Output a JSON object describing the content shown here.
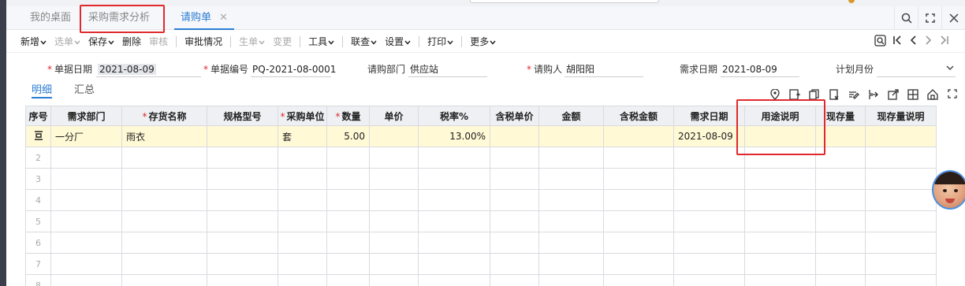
{
  "tabs": [
    {
      "label": "我的桌面"
    },
    {
      "label": "采购需求分析"
    },
    {
      "label": "请购单"
    }
  ],
  "tab_close_glyph": "✕",
  "window_tools": [
    "search-icon",
    "expand-icon",
    "close-icon"
  ],
  "toolbar": [
    {
      "label": "新增",
      "caret": true,
      "disabled": false
    },
    {
      "label": "选单",
      "caret": true,
      "disabled": true
    },
    {
      "label": "保存",
      "caret": true,
      "disabled": false
    },
    {
      "label": "删除",
      "caret": false,
      "disabled": false
    },
    {
      "label": "审核",
      "caret": false,
      "disabled": true
    },
    {
      "label": "审批情况",
      "caret": false,
      "disabled": false
    },
    {
      "label": "生单",
      "caret": true,
      "disabled": true
    },
    {
      "label": "变更",
      "caret": false,
      "disabled": true
    },
    {
      "label": "工具",
      "caret": true,
      "disabled": false
    },
    {
      "label": "联查",
      "caret": true,
      "disabled": false
    },
    {
      "label": "设置",
      "caret": true,
      "disabled": false
    },
    {
      "label": "打印",
      "caret": true,
      "disabled": false
    },
    {
      "label": "更多",
      "caret": true,
      "disabled": false
    }
  ],
  "form": {
    "date_label": "单据日期",
    "date_value": "2021-08-09",
    "code_label": "单据编号",
    "code_value": "PQ-2021-08-0001",
    "dept_label": "请购部门",
    "dept_value": "供应站",
    "person_label": "请购人",
    "person_value": "胡阳阳",
    "demand_date_label": "需求日期",
    "demand_date_value": "2021-08-09",
    "plan_month_label": "计划月份",
    "plan_month_value": ""
  },
  "subtabs": [
    {
      "label": "明细"
    },
    {
      "label": "汇总"
    }
  ],
  "table": {
    "columns": [
      {
        "label": "序号",
        "required": false
      },
      {
        "label": "需求部门",
        "required": false
      },
      {
        "label": "存货名称",
        "required": true
      },
      {
        "label": "规格型号",
        "required": false
      },
      {
        "label": "采购单位",
        "required": true
      },
      {
        "label": "数量",
        "required": true
      },
      {
        "label": "单价",
        "required": false
      },
      {
        "label": "税率%",
        "required": false
      },
      {
        "label": "含税单价",
        "required": false
      },
      {
        "label": "金额",
        "required": false
      },
      {
        "label": "含税金额",
        "required": false
      },
      {
        "label": "需求日期",
        "required": false
      },
      {
        "label": "用途说明",
        "required": false
      },
      {
        "label": "现存量",
        "required": false
      },
      {
        "label": "现存量说明",
        "required": false
      }
    ],
    "rows": [
      [
        "",
        "一分厂",
        "雨衣",
        "",
        "套",
        "5.00",
        "",
        "13.00%",
        "",
        "",
        "",
        "2021-08-09",
        "",
        "",
        ""
      ],
      [
        "2",
        "",
        "",
        "",
        "",
        "",
        "",
        "",
        "",
        "",
        "",
        "",
        "",
        "",
        ""
      ],
      [
        "3",
        "",
        "",
        "",
        "",
        "",
        "",
        "",
        "",
        "",
        "",
        "",
        "",
        "",
        ""
      ],
      [
        "4",
        "",
        "",
        "",
        "",
        "",
        "",
        "",
        "",
        "",
        "",
        "",
        "",
        "",
        ""
      ],
      [
        "5",
        "",
        "",
        "",
        "",
        "",
        "",
        "",
        "",
        "",
        "",
        "",
        "",
        "",
        ""
      ],
      [
        "6",
        "",
        "",
        "",
        "",
        "",
        "",
        "",
        "",
        "",
        "",
        "",
        "",
        "",
        ""
      ],
      [
        "7",
        "",
        "",
        "",
        "",
        "",
        "",
        "",
        "",
        "",
        "",
        "",
        "",
        "",
        ""
      ],
      [
        "8",
        "",
        "",
        "",
        "",
        "",
        "",
        "",
        "",
        "",
        "",
        "",
        "",
        "",
        ""
      ]
    ]
  },
  "colors": {
    "accent": "#2b7cd3",
    "highlight": "#e0292c",
    "selected_row": "#fff9d6"
  }
}
